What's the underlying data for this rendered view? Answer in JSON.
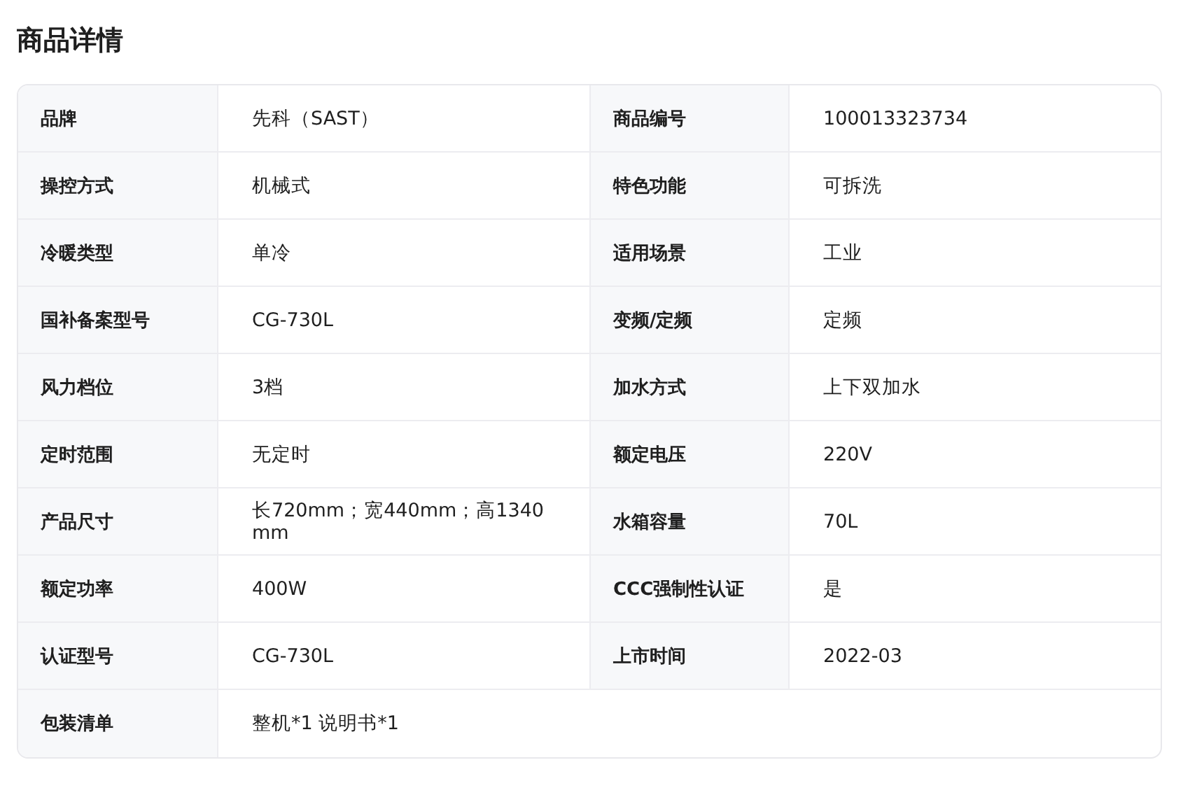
{
  "title": "商品详情",
  "rows": [
    [
      {
        "label": "品牌",
        "value": "先科（SAST）"
      },
      {
        "label": "商品编号",
        "value": "100013323734"
      }
    ],
    [
      {
        "label": "操控方式",
        "value": "机械式"
      },
      {
        "label": "特色功能",
        "value": "可拆洗"
      }
    ],
    [
      {
        "label": "冷暖类型",
        "value": "单冷"
      },
      {
        "label": "适用场景",
        "value": "工业"
      }
    ],
    [
      {
        "label": "国补备案型号",
        "value": "CG-730L"
      },
      {
        "label": "变频/定频",
        "value": "定频"
      }
    ],
    [
      {
        "label": "风力档位",
        "value": "3档"
      },
      {
        "label": "加水方式",
        "value": "上下双加水"
      }
    ],
    [
      {
        "label": "定时范围",
        "value": "无定时"
      },
      {
        "label": "额定电压",
        "value": "220V"
      }
    ],
    [
      {
        "label": "产品尺寸",
        "value": "长720mm；宽440mm；高1340 mm"
      },
      {
        "label": "水箱容量",
        "value": "70L"
      }
    ],
    [
      {
        "label": "额定功率",
        "value": "400W"
      },
      {
        "label": "CCC强制性认证",
        "value": "是"
      }
    ],
    [
      {
        "label": "认证型号",
        "value": "CG-730L"
      },
      {
        "label": "上市时间",
        "value": "2022-03"
      }
    ],
    [
      {
        "label": "包装清单",
        "value": "整机*1 说明书*1"
      }
    ]
  ]
}
